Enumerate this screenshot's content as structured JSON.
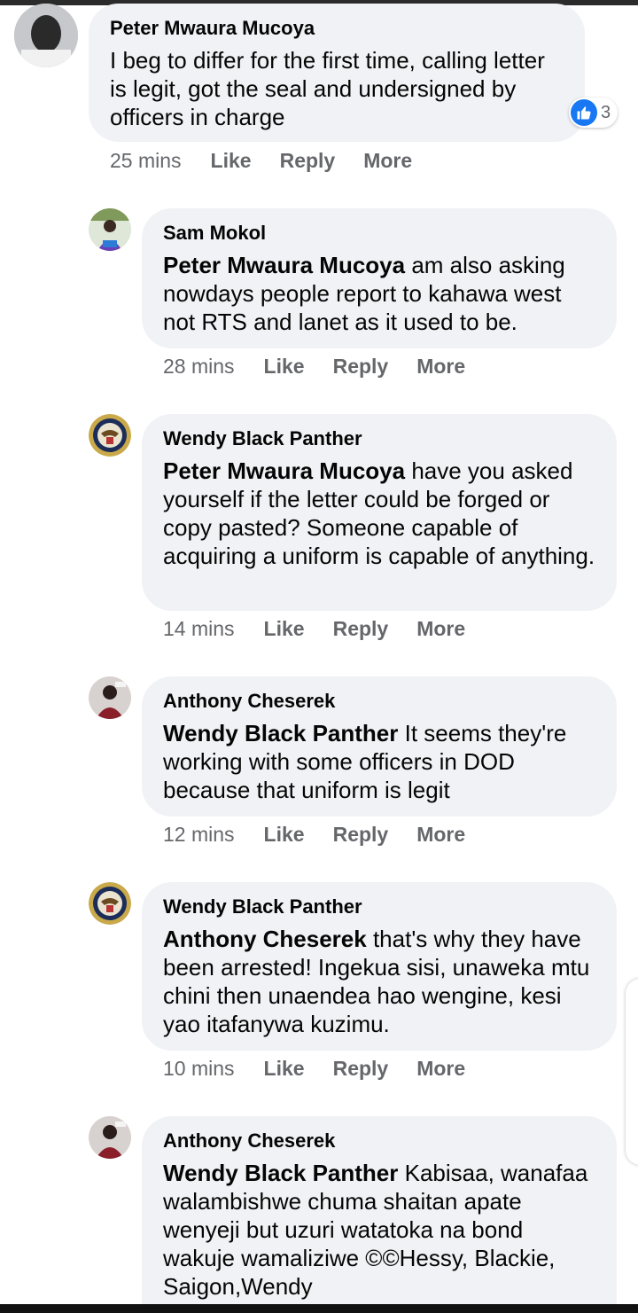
{
  "comments": [
    {
      "author": "Peter Mwaura Mucoya",
      "mention": "",
      "text": "I beg to differ for the first time, calling letter is legit, got the seal and undersigned by officers in charge",
      "time": "25 mins",
      "like_label": "Like",
      "reply_label": "Reply",
      "more_label": "More",
      "reaction_count": "3",
      "avatar_icon": "person-avatar-icon"
    },
    {
      "author": "Sam Mokol",
      "mention": "Peter Mwaura Mucoya",
      "text": " am also asking nowdays people report to kahawa west not RTS and lanet as it used to be.",
      "time": "28 mins",
      "like_label": "Like",
      "reply_label": "Reply",
      "more_label": "More",
      "avatar_icon": "person-avatar-icon"
    },
    {
      "author": "Wendy Black Panther",
      "mention": "Peter Mwaura Mucoya",
      "text": " have you asked yourself if the letter could be forged or copy pasted? Someone capable of acquiring a uniform is capable of anything.",
      "time": "14 mins",
      "like_label": "Like",
      "reply_label": "Reply",
      "more_label": "More",
      "avatar_icon": "seal-avatar-icon"
    },
    {
      "author": "Anthony Cheserek",
      "mention": "Wendy Black Panther",
      "text": " It seems they're working with some officers in DOD because that uniform is legit",
      "time": "12 mins",
      "like_label": "Like",
      "reply_label": "Reply",
      "more_label": "More",
      "avatar_icon": "person-avatar-icon"
    },
    {
      "author": "Wendy Black Panther",
      "mention": "Anthony Cheserek",
      "text": " that's why they have been arrested! Ingekua sisi, unaweka mtu chini then unaendea hao wengine, kesi yao itafanywa kuzimu.",
      "time": "10 mins",
      "like_label": "Like",
      "reply_label": "Reply",
      "more_label": "More",
      "avatar_icon": "seal-avatar-icon"
    },
    {
      "author": "Anthony Cheserek",
      "mention": "Wendy Black Panther",
      "text": " Kabisaa, wanafaa walambishwe chuma shaitan apate wenyeji but uzuri watatoka na bond wakuje wamaliziwe ©©Hessy, Blackie, Saigon,Wendy",
      "avatar_icon": "person-avatar-icon"
    }
  ],
  "colors": {
    "bubble": "#f0f2f5",
    "meta_text": "#65676b",
    "like_blue": "#1877f2"
  }
}
